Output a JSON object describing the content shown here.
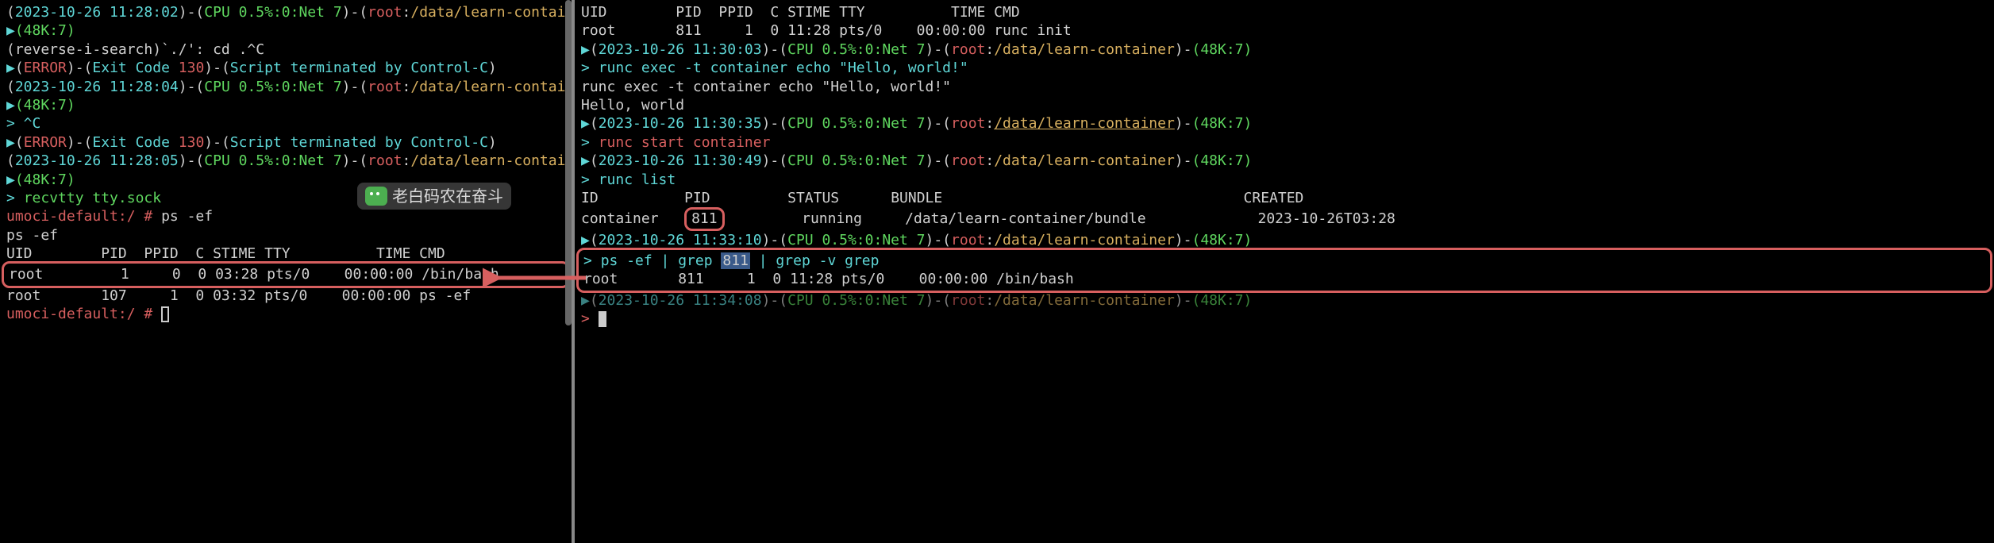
{
  "left": {
    "l1": {
      "ts": "2023-10-26 11:28:02",
      "sys": "CPU 0.5%:0:Net 7",
      "user": "root",
      "path": "/data/learn-container"
    },
    "l2": "(48K:7)",
    "l3": "(reverse-i-search)`./': cd .^C",
    "l4": {
      "err": "ERROR",
      "exit": "Exit Code ",
      "code": "130",
      "msg": "Script terminated by Control-C"
    },
    "l5": {
      "ts": "2023-10-26 11:28:04",
      "sys": "CPU 0.5%:0:Net 7",
      "user": "root",
      "path": "/data/learn-container"
    },
    "l6": "(48K:7)",
    "l7": "> ^C",
    "l8": {
      "err": "ERROR",
      "exit": "Exit Code ",
      "code": "130",
      "msg": "Script terminated by Control-C"
    },
    "l9": {
      "ts": "2023-10-26 11:28:05",
      "sys": "CPU 0.5%:0:Net 7",
      "user": "root",
      "path": "/data/learn-container"
    },
    "l10": "(48K:7)",
    "l11_prompt": "> ",
    "l11_cmd": "recvtty tty.sock",
    "l12_prompt": "umoci-default:/ # ",
    "l12_cmd": "ps -ef",
    "l13": "ps -ef",
    "l14": "UID        PID  PPID  C STIME TTY          TIME CMD",
    "l15": "root         1     0  0 03:28 pts/0    00:00:00 /bin/bash",
    "l16": "root       107     1  0 03:32 pts/0    00:00:00 ps -ef",
    "l17": "umoci-default:/ # "
  },
  "right": {
    "l1": "UID        PID  PPID  C STIME TTY          TIME CMD",
    "l2": "root       811     1  0 11:28 pts/0    00:00:00 runc init",
    "l3": {
      "ts": "2023-10-26 11:30:03",
      "sys": "CPU 0.5%:0:Net 7",
      "user": "root",
      "path": "/data/learn-container",
      "tail": "(48K:7)"
    },
    "l4_cmd": "runc exec -t container echo \"Hello, world!\"",
    "l5": "runc exec -t container echo \"Hello, world!\"",
    "l6": "Hello, world",
    "l7": {
      "ts": "2023-10-26 11:30:35",
      "sys": "CPU 0.5%:0:Net 7",
      "user": "root",
      "path": "/data/learn-container",
      "tail": "(48K:7)"
    },
    "l8_cmd": "runc start container",
    "l9": {
      "ts": "2023-10-26 11:30:49",
      "sys": "CPU 0.5%:0:Net 7",
      "user": "root",
      "path": "/data/learn-container",
      "tail": "(48K:7)"
    },
    "l10_cmd": "runc list",
    "l11_h": {
      "id": "ID",
      "pid": "PID",
      "status": "STATUS",
      "bundle": "BUNDLE",
      "created": "CREATED"
    },
    "l11_r": {
      "id": "container",
      "pid": "811",
      "status": "running",
      "bundle": "/data/learn-container/bundle",
      "created": "2023-10-26T03:28"
    },
    "l12": {
      "ts": "2023-10-26 11:33:10",
      "sys": "CPU 0.5%:0:Net 7",
      "user": "root",
      "path": "/data/learn-container",
      "tail": "(48K:7)"
    },
    "l13_pre": "ps -ef | grep ",
    "l13_hl": "811",
    "l13_post": " | grep -v grep",
    "l14": "root       811     1  0 11:28 pts/0    00:00:00 /bin/bash",
    "l15": {
      "ts": "2023-10-26 11:34:08",
      "sys": "CPU 0.5%:0:Net 7",
      "user": "root",
      "path": "/data/learn-container",
      "tail": "(48K:7)"
    },
    "l16_prompt": "> "
  },
  "watermark": "老白码农在奋斗"
}
